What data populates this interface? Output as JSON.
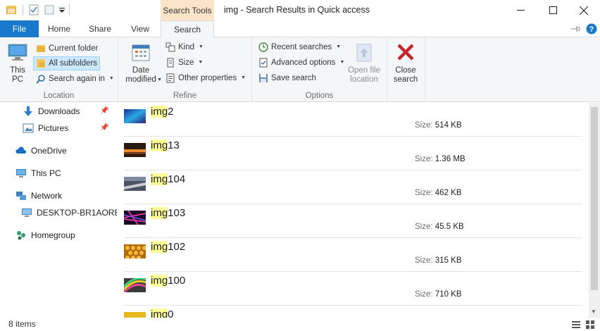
{
  "window": {
    "title": "img - Search Results in Quick access",
    "contextual_tab_group": "Search Tools"
  },
  "tabs": [
    {
      "label": "File"
    },
    {
      "label": "Home"
    },
    {
      "label": "Share"
    },
    {
      "label": "View"
    },
    {
      "label": "Search"
    }
  ],
  "ribbon": {
    "location": {
      "group_label": "Location",
      "this_pc": "This PC",
      "current_folder": "Current folder",
      "all_subfolders": "All subfolders",
      "search_again_in": "Search again in"
    },
    "refine": {
      "group_label": "Refine",
      "date_modified": "Date modified",
      "kind": "Kind",
      "size": "Size",
      "other_properties": "Other properties"
    },
    "options": {
      "group_label": "Options",
      "recent_searches": "Recent searches",
      "advanced_options": "Advanced options",
      "save_search": "Save search",
      "open_file_location": "Open file location"
    },
    "close": {
      "close_search": "Close search"
    }
  },
  "nav": {
    "items": [
      {
        "label": "Downloads",
        "icon": "download-arrow-icon",
        "pinned": true
      },
      {
        "label": "Pictures",
        "icon": "pictures-icon",
        "pinned": true
      },
      {
        "label": "OneDrive",
        "icon": "cloud-icon"
      },
      {
        "label": "This PC",
        "icon": "computer-icon"
      },
      {
        "label": "Network",
        "icon": "network-icon"
      },
      {
        "label": "DESKTOP-BR1AORE",
        "icon": "monitor-icon"
      },
      {
        "label": "Homegroup",
        "icon": "homegroup-icon"
      }
    ]
  },
  "results": {
    "size_label": "Size:",
    "items": [
      {
        "match": "img",
        "rest": "2",
        "size": "514 KB"
      },
      {
        "match": "img",
        "rest": "13",
        "size": "1.36 MB"
      },
      {
        "match": "img",
        "rest": "104",
        "size": "462 KB"
      },
      {
        "match": "img",
        "rest": "103",
        "size": "45.5 KB"
      },
      {
        "match": "img",
        "rest": "102",
        "size": "315 KB"
      },
      {
        "match": "img",
        "rest": "100",
        "size": "710 KB"
      },
      {
        "match": "img",
        "rest": "0",
        "size": ""
      }
    ]
  },
  "status": {
    "count": "8 items"
  },
  "colors": {
    "file_tab": "#1979ca",
    "contextual_tab": "#fbe4c8",
    "highlight": "#ffff9a",
    "selected_button": "#cce8ff"
  }
}
